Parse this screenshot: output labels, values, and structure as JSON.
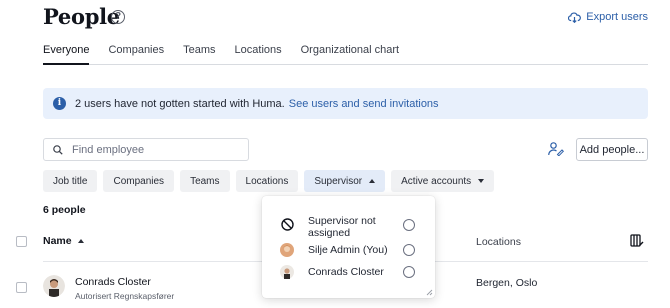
{
  "header": {
    "title": "People",
    "help_icon": "?",
    "export_label": "Export users"
  },
  "tabs": [
    {
      "label": "Everyone",
      "active": true
    },
    {
      "label": "Companies",
      "active": false
    },
    {
      "label": "Teams",
      "active": false
    },
    {
      "label": "Locations",
      "active": false
    },
    {
      "label": "Organizational chart",
      "active": false
    }
  ],
  "banner": {
    "icon": "i",
    "text": "2 users have not gotten started with Huma.",
    "link": "See users and send invitations"
  },
  "search": {
    "placeholder": "Find employee",
    "value": ""
  },
  "actions": {
    "add_people_label": "Add people..."
  },
  "filters": {
    "job_title": "Job title",
    "companies": "Companies",
    "teams": "Teams",
    "locations": "Locations",
    "supervisor": "Supervisor",
    "active_accounts": "Active accounts"
  },
  "count_label": "6 people",
  "table": {
    "col_name": "Name",
    "col_locations": "Locations",
    "rows": [
      {
        "name": "Conrads Closter",
        "role": "Autorisert Regnskapsfører",
        "location": "Bergen, Oslo"
      }
    ]
  },
  "supervisor_dropdown": {
    "options": [
      {
        "label_line1": "Supervisor not",
        "label_line2": "assigned",
        "icon": "not-allowed-icon",
        "selected": false
      },
      {
        "label": "Silje Admin (You)",
        "icon": "avatar",
        "selected": false
      },
      {
        "label": "Conrads Closter",
        "icon": "avatar",
        "selected": false
      }
    ]
  },
  "colors": {
    "accent": "#2c5fa8",
    "banner_bg": "#e8f0fc",
    "filter_bg": "#f0f1f3"
  }
}
